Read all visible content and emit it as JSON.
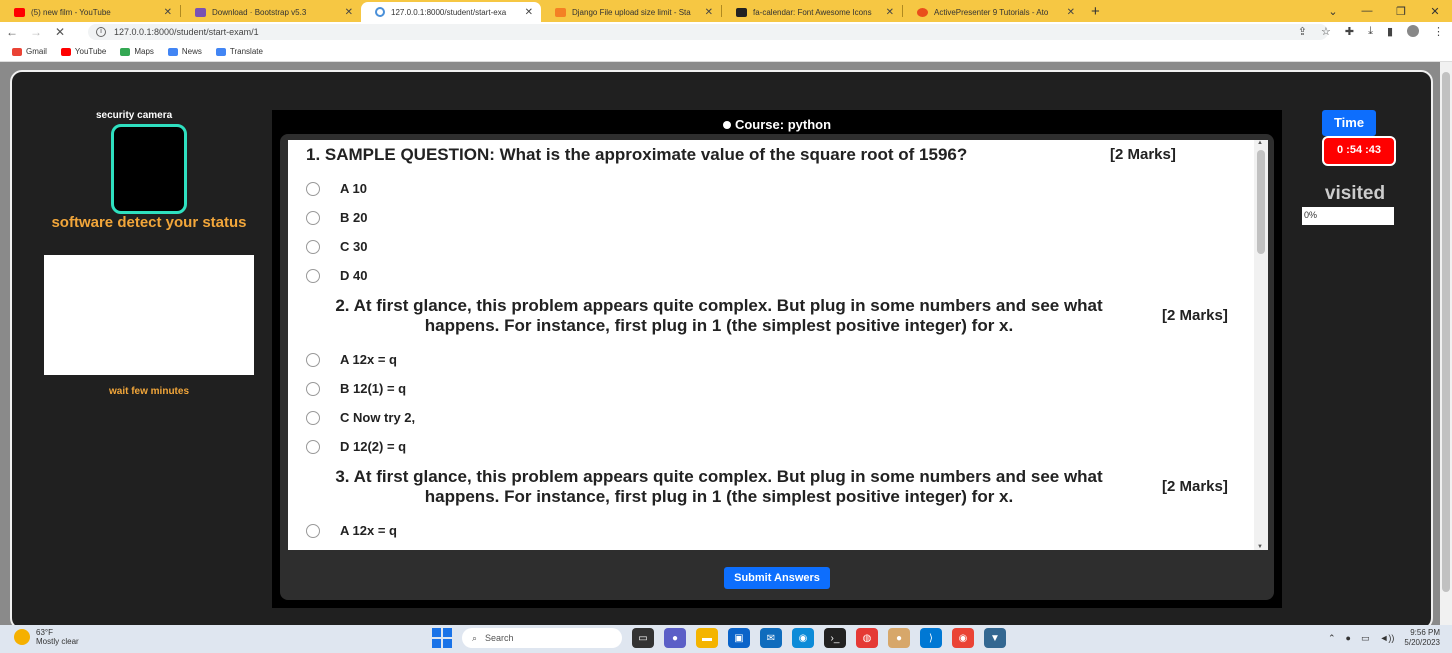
{
  "browser": {
    "tabs": [
      {
        "title": "(5) new film - YouTube",
        "color": "#ff0000",
        "active": false
      },
      {
        "title": "Download · Bootstrap v5.3",
        "color": "#7952b3",
        "active": false
      },
      {
        "title": "127.0.0.1:8000/student/start-exa",
        "color": "#4a90d9",
        "active": true
      },
      {
        "title": "Django File upload size limit - Sta",
        "color": "#f48024",
        "active": false
      },
      {
        "title": "fa-calendar: Font Awesome Icons",
        "color": "#222222",
        "active": false
      },
      {
        "title": "ActivePresenter 9 Tutorials - Ato",
        "color": "#e94e1b",
        "active": false
      }
    ],
    "url": "127.0.0.1:8000/student/start-exam/1",
    "bookmarks": [
      "Gmail",
      "YouTube",
      "Maps",
      "News",
      "Translate"
    ]
  },
  "sidebar": {
    "camera_label": "security camera",
    "detect_title": "software detect your status",
    "wait_text": "wait few minutes"
  },
  "exam": {
    "course_label": "Course: python",
    "questions": [
      {
        "text": "1. SAMPLE QUESTION: What is the approximate value of the square root of 1596?",
        "marks": "[2 Marks]",
        "options": [
          "A 10",
          "B 20",
          "C 30",
          "D 40"
        ]
      },
      {
        "text": "2. At first glance, this problem appears quite complex. But plug in some numbers and see what happens. For instance, first plug in 1 (the simplest positive integer) for x.",
        "marks": "[2 Marks]",
        "options": [
          "A 12x = q",
          "B 12(1) = q",
          "C Now try 2,",
          "D 12(2) = q"
        ]
      },
      {
        "text": "3. At first glance, this problem appears quite complex. But plug in some numbers and see what happens. For instance, first plug in 1 (the simplest positive integer) for x.",
        "marks": "[2 Marks]",
        "options": [
          "A 12x = q"
        ]
      }
    ],
    "submit_label": "Submit Answers"
  },
  "timer": {
    "label": "Time",
    "value": "0 :54 :43",
    "visited_label": "visited",
    "progress_text": "0%"
  },
  "taskbar": {
    "temp": "63°F",
    "weather": "Mostly clear",
    "search_placeholder": "Search",
    "time": "9:56 PM",
    "date": "5/20/2023"
  }
}
